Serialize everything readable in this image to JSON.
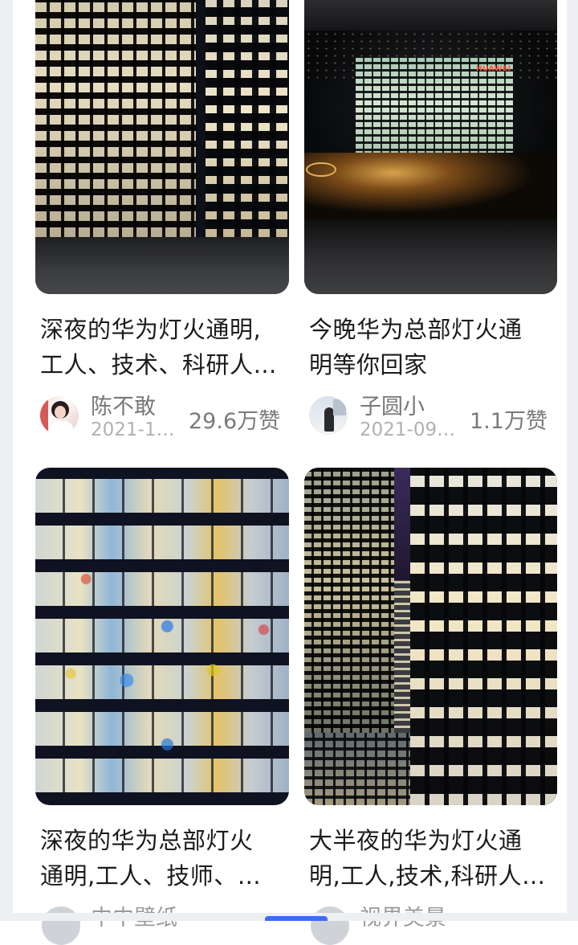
{
  "cards": [
    {
      "title_lines": [
        "深夜的华为灯火通明,",
        "工人、技术、科研人…"
      ],
      "author": "陈不敢",
      "date": "2021-1…",
      "likes": "29.6万赞",
      "avatar_icon": "woman-portrait-avatar"
    },
    {
      "title_lines": [
        "今晚华为总部灯火通",
        "明等你回家"
      ],
      "author": "子圆小",
      "date": "2021-09…",
      "likes": "1.1万赞",
      "image_sign": "HUAWEI",
      "avatar_icon": "silhouette-avatar"
    },
    {
      "title_lines": [
        "深夜的华为总部灯火",
        "通明,工人、技师、…"
      ],
      "author": "中中壁纸",
      "avatar_icon": "avatar"
    },
    {
      "title_lines": [
        "大半夜的华为灯火通",
        "明,工人,技术,科研人…"
      ],
      "author": "视界美景",
      "avatar_icon": "avatar"
    }
  ],
  "colors": {
    "accent": "#3b6ef5",
    "title_text": "#1b1b1b",
    "meta_text": "#7a7a7a",
    "date_text": "#b1b1b1",
    "rail": "#eeeff3"
  }
}
